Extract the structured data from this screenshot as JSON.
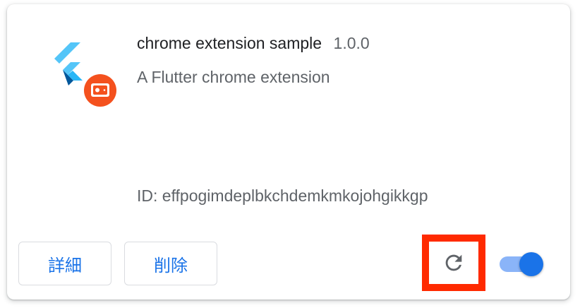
{
  "extension": {
    "name": "chrome extension sample",
    "version": "1.0.0",
    "description": "A Flutter chrome extension",
    "id_text": "ID: effpogimdeplbkchdemkmkojohgikkgp",
    "icon": "flutter-logo-with-app-badge",
    "enabled": true
  },
  "actions": {
    "details_label": "詳細",
    "remove_label": "削除",
    "reload_icon": "reload-icon"
  },
  "colors": {
    "accent": "#1a73e8",
    "toggle_track": "#8ab4f8",
    "highlight": "#ff2a00",
    "text_primary": "#202124",
    "text_secondary": "#5f6368",
    "flutter_light": "#54c5f8",
    "flutter_dark": "#01579b",
    "badge": "#f4511e"
  }
}
